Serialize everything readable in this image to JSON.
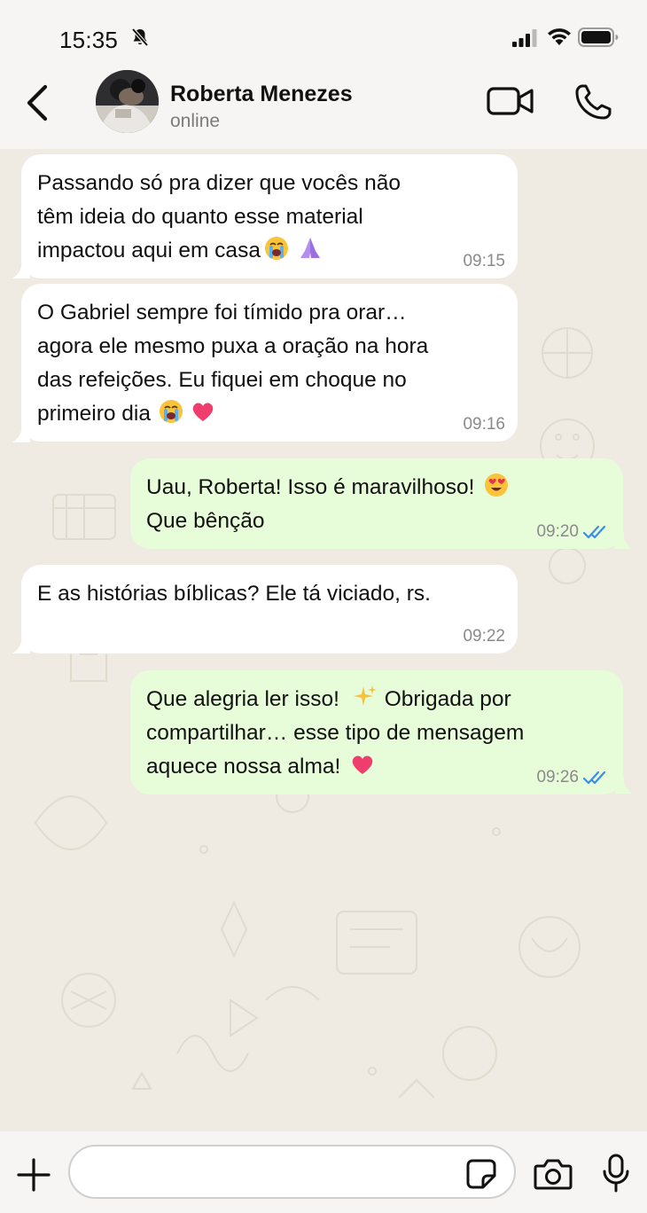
{
  "status_bar": {
    "time": "15:35",
    "icons": [
      "bell-slash-icon",
      "signal-icon",
      "wifi-icon",
      "battery-icon"
    ]
  },
  "header": {
    "contact_name": "Roberta Menezes",
    "status": "online",
    "icons": [
      "back-chevron-icon",
      "video-call-icon",
      "phone-icon"
    ]
  },
  "messages": [
    {
      "direction": "in",
      "text": "Passando só pra dizer que vocês não\ntêm ideia do quanto esse material\nimpactou aqui em casa",
      "emojis": [
        "loudly-crying-face",
        "folded-hands"
      ],
      "time": "09:15"
    },
    {
      "direction": "in",
      "text": "O Gabriel sempre foi tímido pra orar…\nagora ele mesmo puxa a oração na hora\ndas refeições. Eu fiquei em choque no\nprimeiro dia",
      "emojis": [
        "loudly-crying-face",
        "red-heart"
      ],
      "time": "09:16"
    },
    {
      "direction": "out",
      "text": "Uau, Roberta! Isso é maravilhoso!",
      "text2": "Que bênção",
      "emojis": [
        "heart-eyes-face"
      ],
      "time": "09:20",
      "status": "read"
    },
    {
      "direction": "in",
      "text": "E as histórias bíblicas? Ele tá viciado, rs.",
      "emojis": [],
      "time": "09:22"
    },
    {
      "direction": "out",
      "text": "Que alegria ler isso!",
      "text_after": "Obrigada por",
      "text2": "compartilhar… esse tipo de mensagem",
      "text3": "aquece nossa alma!",
      "emojis": [
        "sparkles",
        "red-heart"
      ],
      "time": "09:26",
      "status": "read"
    }
  ],
  "composer": {
    "input_value": "",
    "input_placeholder": "",
    "icons": [
      "plus-icon",
      "sticker-icon",
      "camera-icon",
      "microphone-icon"
    ]
  },
  "colors": {
    "incoming_bubble": "#ffffff",
    "outgoing_bubble": "#e7fcd9",
    "read_ticks": "#3b8de8",
    "chat_background": "#efeae2"
  }
}
